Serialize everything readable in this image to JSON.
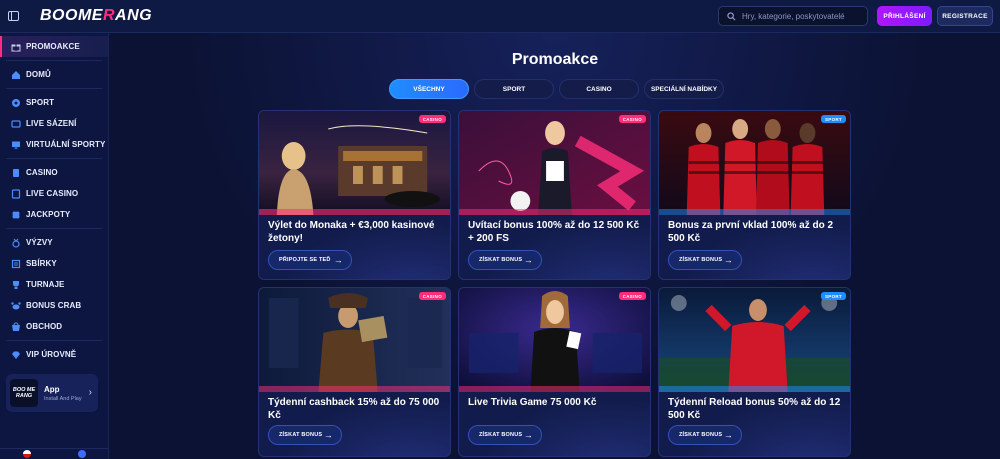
{
  "header": {
    "logo_main": "BOOME",
    "logo_accent": "R",
    "logo_end": "ANG",
    "search_placeholder": "Hry, kategorie, poskytovatelé",
    "login_label": "PŘIHLÁŠENÍ",
    "register_label": "REGISTRACE"
  },
  "sidebar": {
    "items": [
      {
        "label": "PROMOAKCE",
        "icon": "gift-icon"
      },
      {
        "label": "DOMŮ",
        "icon": "home-icon"
      },
      {
        "label": "SPORT",
        "icon": "soccer-ball-icon"
      },
      {
        "label": "LIVE SÁZENÍ",
        "icon": "live-tv-icon"
      },
      {
        "label": "VIRTUÁLNÍ SPORTY",
        "icon": "monitor-icon"
      },
      {
        "label": "CASINO",
        "icon": "cards-icon"
      },
      {
        "label": "LIVE CASINO",
        "icon": "chip-icon"
      },
      {
        "label": "JACKPOTY",
        "icon": "clover-icon"
      },
      {
        "label": "VÝZVY",
        "icon": "medal-icon"
      },
      {
        "label": "SBÍRKY",
        "icon": "album-icon"
      },
      {
        "label": "TURNAJE",
        "icon": "trophy-icon"
      },
      {
        "label": "BONUS CRAB",
        "icon": "crab-icon"
      },
      {
        "label": "OBCHOD",
        "icon": "shop-icon"
      },
      {
        "label": "VIP ÚROVNĚ",
        "icon": "diamond-icon"
      }
    ],
    "app": {
      "logo_text": "BOO ME RANG",
      "title": "App",
      "subtitle": "Install And Play"
    }
  },
  "main": {
    "title": "Promoakce",
    "tabs": [
      "VŠECHNY",
      "SPORT",
      "CASINO",
      "SPECIÁLNÍ NABÍDKY"
    ],
    "cards": [
      {
        "badge": "CASINO",
        "title": "Výlet do Monaka + €3,000 kasinové žetony!",
        "cta": "PŘIPOJTE SE TEĎ"
      },
      {
        "badge": "CASINO",
        "title": "Uvítací bonus 100% až do 12 500 Kč + 200 FS",
        "cta": "ZÍSKAT BONUS"
      },
      {
        "badge": "SPORT",
        "title": "Bonus za první vklad 100% až do 2 500 Kč",
        "cta": "ZÍSKAT BONUS"
      },
      {
        "badge": "CASINO",
        "title": "Týdenní cashback 15% až do 75 000 Kč",
        "cta": "ZÍSKAT BONUS"
      },
      {
        "badge": "CASINO",
        "title": "Live Trivia Game 75 000 Kč",
        "cta": "ZÍSKAT BONUS"
      },
      {
        "badge": "SPORT",
        "title": "Týdenní Reload bonus 50% až do 12 500 Kč",
        "cta": "ZÍSKAT BONUS"
      }
    ]
  }
}
